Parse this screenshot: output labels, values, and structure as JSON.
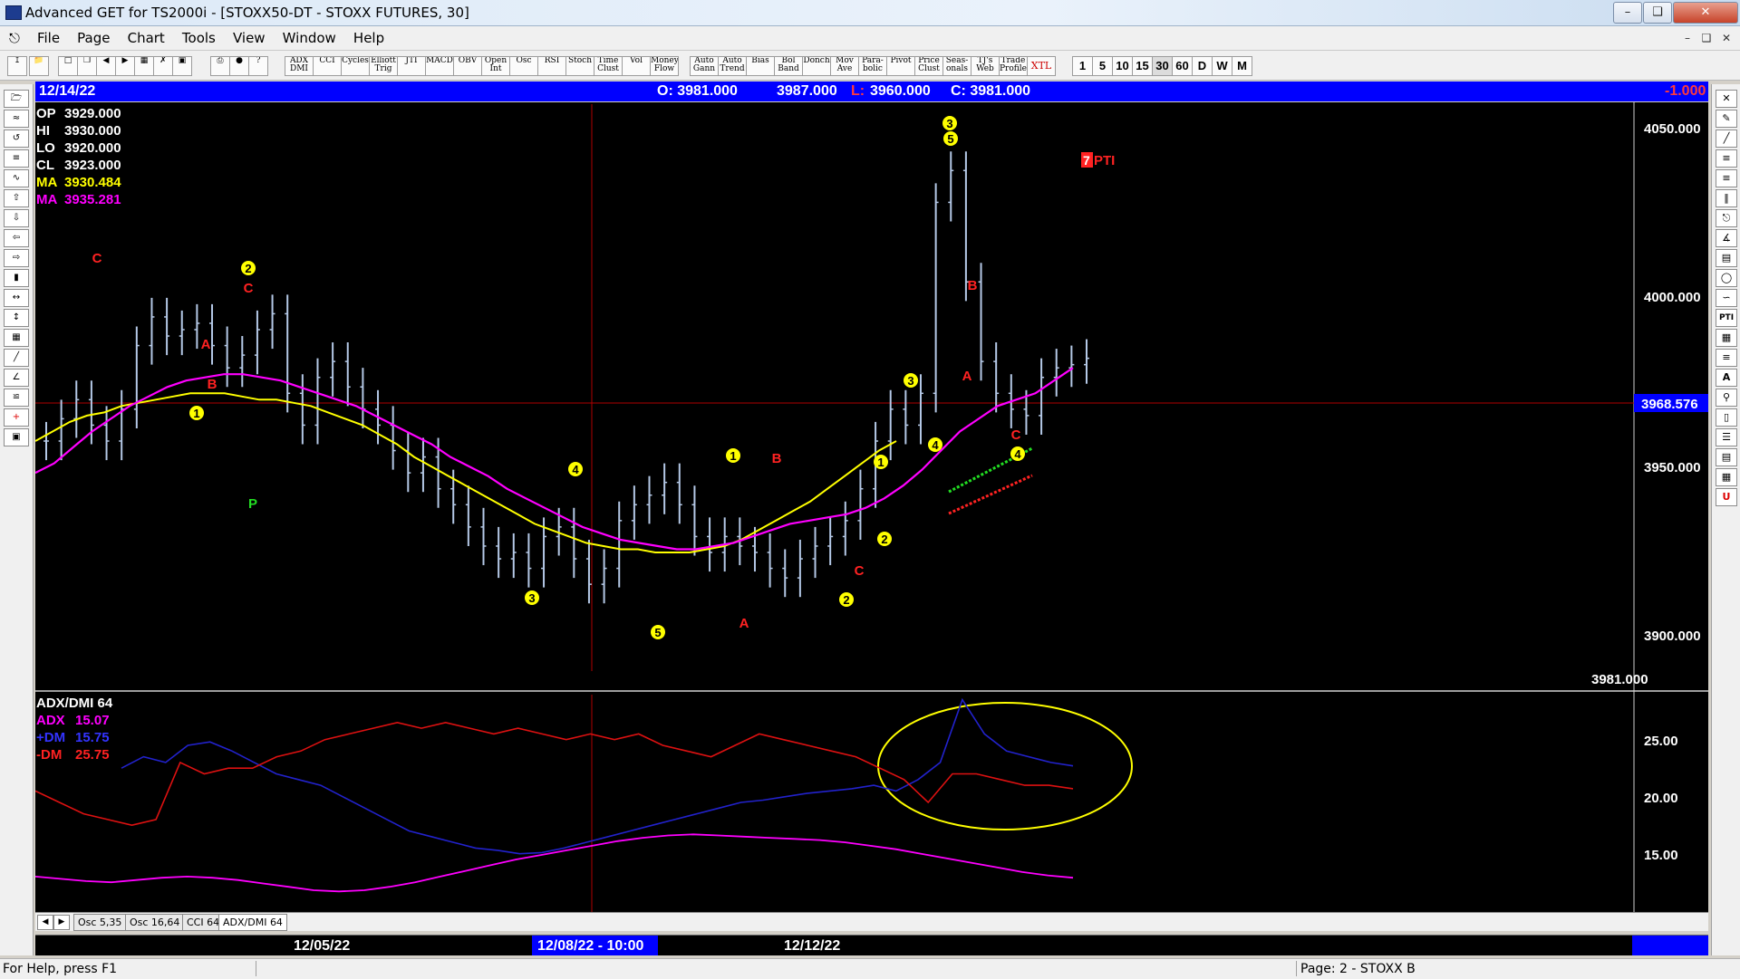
{
  "window": {
    "title": "Advanced GET for TS2000i - [STOXX50-DT - STOXX FUTURES, 30]"
  },
  "menu": [
    "File",
    "Page",
    "Chart",
    "Tools",
    "View",
    "Window",
    "Help"
  ],
  "toolbar": {
    "buttons": [
      "ADX DMI",
      "CCI",
      "Cycles",
      "Elliott Trig",
      "JTI",
      "MACD",
      "OBV",
      "Open Int",
      "Osc",
      "RSI",
      "Stoch",
      "Time Clust",
      "Vol",
      "Money Flow",
      "Auto Gann",
      "Auto Trend",
      "Bias",
      "Bol Band",
      "Donch",
      "Mov Ave",
      "Para-bolic",
      "Pivot",
      "Price Clust",
      "Seas-onals",
      "TJ's Web",
      "Trade Profile",
      "XTL"
    ],
    "intervals": [
      "1",
      "5",
      "10",
      "15",
      "30",
      "60",
      "D",
      "W",
      "M"
    ]
  },
  "info_bar": {
    "date": "12/14/22",
    "open": "O: 3981.000",
    "high": "3987.000",
    "low": "L:",
    "low_val": "3960.000",
    "close": "C: 3981.000",
    "change": "-1.000"
  },
  "price_panel": {
    "readout": [
      {
        "label": "OP",
        "value": "3929.000",
        "color": "#ffffff"
      },
      {
        "label": "HI",
        "value": "3930.000",
        "color": "#ffffff"
      },
      {
        "label": "LO",
        "value": "3920.000",
        "color": "#ffffff"
      },
      {
        "label": "CL",
        "value": "3923.000",
        "color": "#ffffff"
      },
      {
        "label": "MA",
        "value": "3930.484",
        "color": "#ffff00"
      },
      {
        "label": "MA",
        "value": "3935.281",
        "color": "#ff00ff"
      }
    ],
    "price_ticks": [
      "4050.000",
      "4000.000",
      "3950.000",
      "3900.000"
    ],
    "cursor_price": "3968.576",
    "last_price": "3981.000",
    "pti_label": "PTI",
    "pti_digit": "7"
  },
  "indicator_panel": {
    "title": "ADX/DMI 64",
    "legend": [
      {
        "name": "ADX",
        "value": "15.07",
        "color": "#ff00ff"
      },
      {
        "name": "+DM",
        "value": "15.75",
        "color": "#3333ff"
      },
      {
        "name": "-DM",
        "value": "25.75",
        "color": "#ff2222"
      }
    ],
    "ticks": [
      "25.00",
      "20.00",
      "15.00"
    ]
  },
  "tabs": [
    "Osc 5,35",
    "Osc 16,64",
    "CCI 64",
    "ADX/DMI 64"
  ],
  "date_axis": {
    "labels": [
      "12/05/22",
      "12/12/22"
    ],
    "cursor_date": "12/08/22 - 10:00"
  },
  "status": {
    "left": "For Help, press F1",
    "right": "Page: 2 - STOXX B"
  },
  "chart_data": {
    "type": "line",
    "xlabel": "",
    "ylabel": "",
    "ylim": [
      3885,
      4060
    ],
    "series": [
      {
        "name": "STOXX50",
        "color": "#b4c8e6",
        "values": [
          3955,
          3962,
          3968,
          3960,
          3955,
          3965,
          3985,
          3994,
          3988,
          3990,
          3992,
          3985,
          3978,
          3982,
          3990,
          3995,
          3970,
          3960,
          3975,
          3980,
          3972,
          3965,
          3960,
          3952,
          3945,
          3950,
          3940,
          3935,
          3928,
          3922,
          3918,
          3920,
          3915,
          3925,
          3928,
          3918,
          3910,
          3915,
          3930,
          3935,
          3938,
          3942,
          3935,
          3925,
          3920,
          3925,
          3922,
          3920,
          3915,
          3912,
          3918,
          3922,
          3925,
          3930,
          3940,
          3955,
          3965,
          3960,
          3970,
          4030,
          4040,
          4005,
          3980,
          3970,
          3965,
          3963,
          3975,
          3978,
          3979,
          3981
        ]
      },
      {
        "name": "MA",
        "color": "#ffff00",
        "values": [
          3955,
          3958,
          3961,
          3963,
          3964,
          3966,
          3967,
          3968,
          3969,
          3970,
          3970,
          3970,
          3969,
          3968,
          3968,
          3967,
          3966,
          3964,
          3962,
          3960,
          3957,
          3954,
          3950,
          3947,
          3944,
          3941,
          3938,
          3935,
          3932,
          3929,
          3927,
          3925,
          3923,
          3922,
          3921,
          3921,
          3920,
          3920,
          3920,
          3921,
          3922,
          3924,
          3927,
          3930,
          3933,
          3936,
          3940,
          3944,
          3948,
          3952,
          3955
        ]
      },
      {
        "name": "MA",
        "color": "#ff00ff",
        "values": [
          3945,
          3948,
          3953,
          3958,
          3962,
          3966,
          3969,
          3972,
          3974,
          3975,
          3976,
          3976,
          3975,
          3974,
          3972,
          3970,
          3968,
          3966,
          3963,
          3960,
          3957,
          3954,
          3950,
          3947,
          3944,
          3940,
          3937,
          3934,
          3931,
          3928,
          3926,
          3924,
          3923,
          3922,
          3921,
          3921,
          3922,
          3923,
          3925,
          3927,
          3929,
          3930,
          3931,
          3932,
          3934,
          3937,
          3941,
          3946,
          3952,
          3958,
          3962,
          3966,
          3968,
          3970,
          3974,
          3978
        ]
      },
      {
        "name": "ADX",
        "color": "#ff00ff",
        "values": [
          13.5,
          13.3,
          13.1,
          13.0,
          13.2,
          13.4,
          13.5,
          13.4,
          13.2,
          12.9,
          12.6,
          12.3,
          12.2,
          12.3,
          12.6,
          13.0,
          13.5,
          14.0,
          14.5,
          15.0,
          15.4,
          15.8,
          16.2,
          16.6,
          16.9,
          17.1,
          17.2,
          17.1,
          17.0,
          16.9,
          16.8,
          16.7,
          16.5,
          16.2,
          15.9,
          15.5,
          15.1,
          14.7,
          14.3,
          13.9,
          13.6,
          13.4
        ]
      },
      {
        "name": "+DM",
        "color": "#2222cc",
        "values": [
          23.0,
          24.0,
          23.5,
          25.0,
          25.3,
          24.5,
          23.5,
          22.5,
          22.0,
          21.5,
          20.5,
          19.5,
          18.5,
          17.5,
          17.0,
          16.5,
          16.0,
          15.8,
          15.5,
          15.6,
          16.0,
          16.5,
          17.0,
          17.5,
          18.0,
          18.5,
          19.0,
          19.5,
          20.0,
          20.2,
          20.5,
          20.8,
          21.0,
          21.2,
          21.5,
          21.0,
          22.0,
          23.5,
          29.0,
          26.0,
          24.5,
          24.0,
          23.5,
          23.2
        ]
      },
      {
        "name": "-DM",
        "color": "#dd1111",
        "values": [
          21.0,
          20.0,
          19.0,
          18.5,
          18.0,
          18.5,
          23.5,
          22.5,
          23.0,
          23.0,
          24.0,
          24.5,
          25.5,
          26.0,
          26.5,
          27.0,
          26.5,
          27.0,
          26.5,
          26.0,
          26.5,
          26.0,
          25.5,
          26.0,
          25.5,
          26.0,
          25.0,
          24.5,
          24.0,
          25.0,
          26.0,
          25.5,
          25.0,
          24.5,
          24.0,
          23.0,
          22.0,
          20.0,
          22.5,
          22.5,
          22.0,
          21.5,
          21.5,
          21.2
        ]
      }
    ],
    "annotations": [
      {
        "label": "C",
        "color": "#ff2222"
      },
      {
        "label": "2",
        "color": "#ffff00"
      },
      {
        "label": "C",
        "color": "#ff2222"
      },
      {
        "label": "A",
        "color": "#ff2222"
      },
      {
        "label": "B",
        "color": "#ff2222"
      },
      {
        "label": "1",
        "color": "#ffff00"
      },
      {
        "label": "P",
        "color": "#22dd22"
      },
      {
        "label": "B",
        "color": "#ff2222"
      },
      {
        "label": "4",
        "color": "#ffff00"
      },
      {
        "label": "3",
        "color": "#ffff00"
      },
      {
        "label": "5",
        "color": "#ffff00"
      },
      {
        "label": "A",
        "color": "#ff2222"
      },
      {
        "label": "1",
        "color": "#ffff00"
      },
      {
        "label": "B",
        "color": "#ff2222"
      },
      {
        "label": "C",
        "color": "#ff2222"
      },
      {
        "label": "2",
        "color": "#ffff00"
      },
      {
        "label": "2",
        "color": "#ffff00"
      },
      {
        "label": "1",
        "color": "#ffff00"
      },
      {
        "label": "3",
        "color": "#ffff00"
      },
      {
        "label": "4",
        "color": "#ffff00"
      },
      {
        "label": "3",
        "color": "#ffff00"
      },
      {
        "label": "5",
        "color": "#ffff00"
      },
      {
        "label": "B",
        "color": "#ff2222"
      },
      {
        "label": "A",
        "color": "#ff2222"
      },
      {
        "label": "C",
        "color": "#ff2222"
      },
      {
        "label": "4",
        "color": "#ffff00"
      }
    ]
  }
}
